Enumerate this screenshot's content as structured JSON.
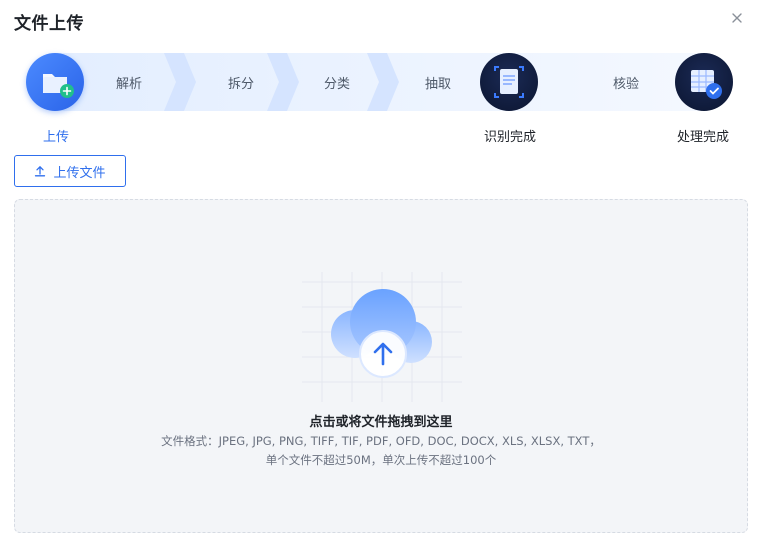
{
  "dialog": {
    "title": "文件上传",
    "close_icon": "close-icon"
  },
  "steps": {
    "upload": "上传",
    "parse": "解析",
    "split": "拆分",
    "classify": "分类",
    "extract": "抽取",
    "recognized": "识别完成",
    "verify": "核验",
    "processed": "处理完成"
  },
  "toolbar": {
    "upload_label": "上传文件",
    "upload_icon": "upload-arrow-icon"
  },
  "dropzone": {
    "title": "点击或将文件拖拽到这里",
    "formats": "文件格式：JPEG, JPG, PNG, TIFF, TIF, PDF, OFD, DOC, DOCX, XLS, XLSX, TXT，",
    "limits": "单个文件不超过50M，单次上传不超过100个",
    "icon": "cloud-upload-icon"
  },
  "colors": {
    "accent": "#2f6fed",
    "step_band": "#eaf2ff",
    "dark_circle": "#0f1a38"
  }
}
